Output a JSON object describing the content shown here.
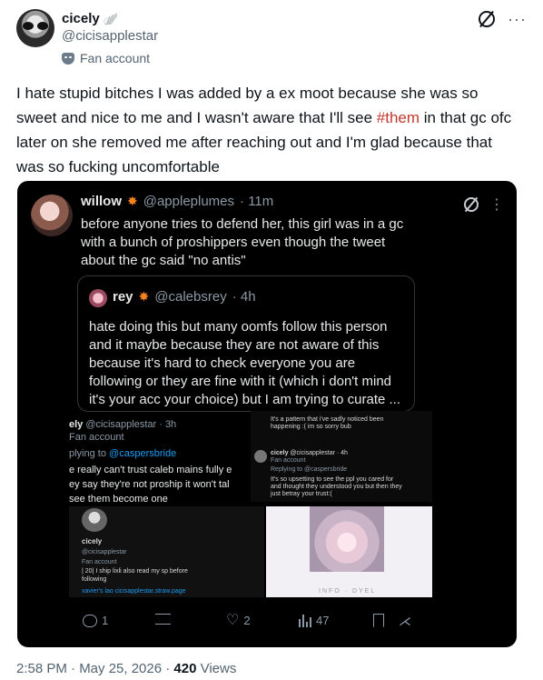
{
  "author": {
    "name": "cicely",
    "handle": "@cicisapplestar",
    "label": "Fan account",
    "badge_icon": "wing-icon"
  },
  "tweet": {
    "text_before": "I hate stupid bitches I was added by a ex moot because she was so sweet and nice to me and I wasn't aware that I'll see ",
    "hashtag": "#them",
    "text_after": " in that gc ofc later on she removed me after reaching out and I'm glad because that was so fucking uncomfortable"
  },
  "embedded": {
    "name": "willow",
    "handle": "@appleplumes",
    "time": "· 11m",
    "text": "before anyone tries to defend her, this girl was in a gc with a bunch of proshippers even though the tweet about the gc said \"no antis\"",
    "quote": {
      "name": "rey",
      "handle": "@calebsrey",
      "time": "· 4h",
      "text": "hate doing this but many oomfs follow this person and it maybe because they are not aware of this because it's hard to check everyone you are following or they are fine with it (which i don't mind it's your acc your choice) but I am trying to curate ..."
    },
    "collage": {
      "left": {
        "name": "ely",
        "handle": "@cicisapplestar · 3h",
        "label": "Fan account",
        "replying": "plying to",
        "replying_handle": "@caspersbride",
        "line1": "e really can't trust caleb mains fully e",
        "line2": "ey say they're not proship it won't tal",
        "line3": "see them become one"
      },
      "right": {
        "line1": "It's a pattern that i've sadly noticed been",
        "line2": "happening :( im so sorry bub",
        "name": "cicely",
        "handle": "@cicisapplestar · 4h",
        "label": "Fan account",
        "replying": "Replying to",
        "replying_handle": "@caspersbride",
        "line3": "It's so upsetting to see the ppl you cared for",
        "line4": "and thought they understood you but then they",
        "line5": "just betray your trust:("
      },
      "bottom_left": {
        "name": "cicely",
        "handle": "@cicisapplestar",
        "label": "Fan account",
        "bio1": "| 20| I ship lixli also read my sp before",
        "bio2": "following",
        "link": "xavier's lao  cicisapplestar.straw.page"
      },
      "bottom_right": {
        "label": "INFO · DYEL"
      }
    },
    "stats": {
      "replies": "1",
      "likes": "2",
      "views": "47"
    }
  },
  "footer": {
    "time": "2:58 PM · May 25, 2026 · ",
    "views": "420",
    "views_label": " Views"
  },
  "colors": {
    "hashtag": "#c0392b",
    "link": "#1d9bf0",
    "secondary_text": "#536471"
  }
}
